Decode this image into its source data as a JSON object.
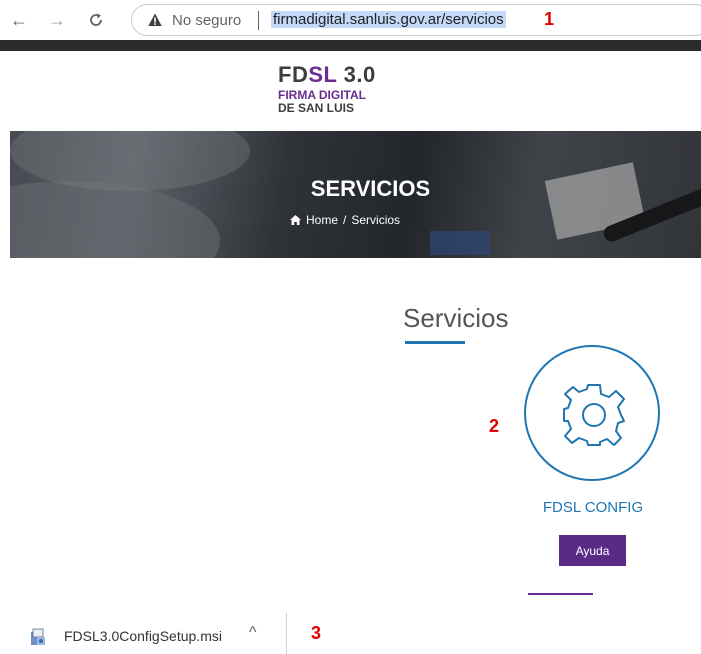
{
  "browser": {
    "back_icon": "back-arrow-icon",
    "forward_icon": "forward-arrow-icon",
    "reload_icon": "reload-icon",
    "security_label": "No seguro",
    "url": "firmadigital.sanluis.gov.ar/servicios"
  },
  "logo": {
    "line1_a": "FD",
    "line1_b": "SL",
    "line1_c": " 3.0",
    "line2": "FIRMA DIGITAL",
    "line3": "DE SAN LUIS"
  },
  "banner": {
    "title": "SERVICIOS",
    "breadcrumb_home": "Home",
    "breadcrumb_sep": "/",
    "breadcrumb_current": "Servicios"
  },
  "main": {
    "section_title": "Servicios",
    "service_name": "FDSL CONFIG",
    "help_button": "Ayuda"
  },
  "downloads": {
    "file_name": "FDSL3.0ConfigSetup.msi",
    "caret": "^"
  },
  "annotations": {
    "one": "1",
    "two": "2",
    "three": "3"
  },
  "colors": {
    "accent_blue": "#1f76b2",
    "brand_purple": "#6a2c91",
    "annotation_red": "#e00000"
  }
}
